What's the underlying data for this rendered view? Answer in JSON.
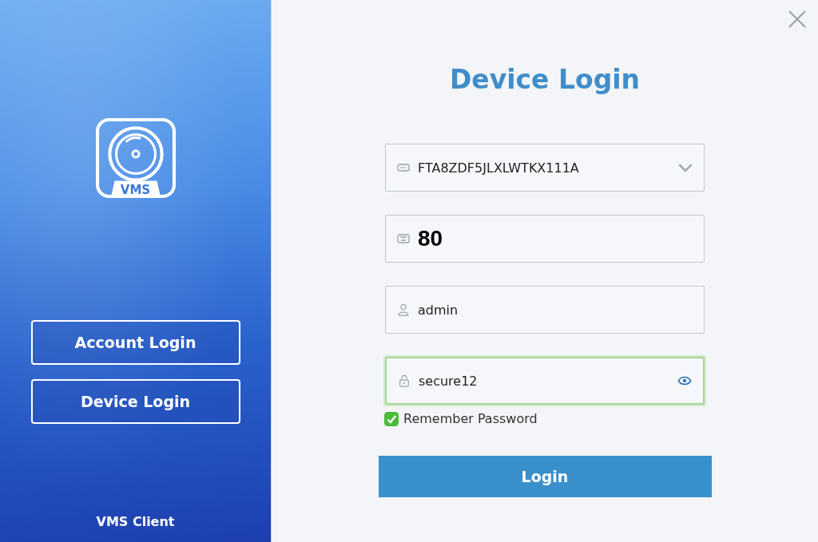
{
  "sidebar": {
    "logo_text": "VMS",
    "buttons": [
      {
        "label": "Account Login"
      },
      {
        "label": "Device Login"
      }
    ],
    "footer": "VMS Client"
  },
  "form": {
    "title": "Device Login",
    "fields": [
      {
        "kind": "select",
        "value": "FTA8ZDF5JLXLWTKX111A",
        "focused": false
      },
      {
        "kind": "port",
        "value": "80",
        "focused": false
      },
      {
        "kind": "user",
        "value": "admin",
        "focused": false
      },
      {
        "kind": "password",
        "value": "secure12",
        "focused": true
      }
    ],
    "remember": {
      "label": "Remember Password",
      "checked": true
    },
    "submit": "Login"
  }
}
